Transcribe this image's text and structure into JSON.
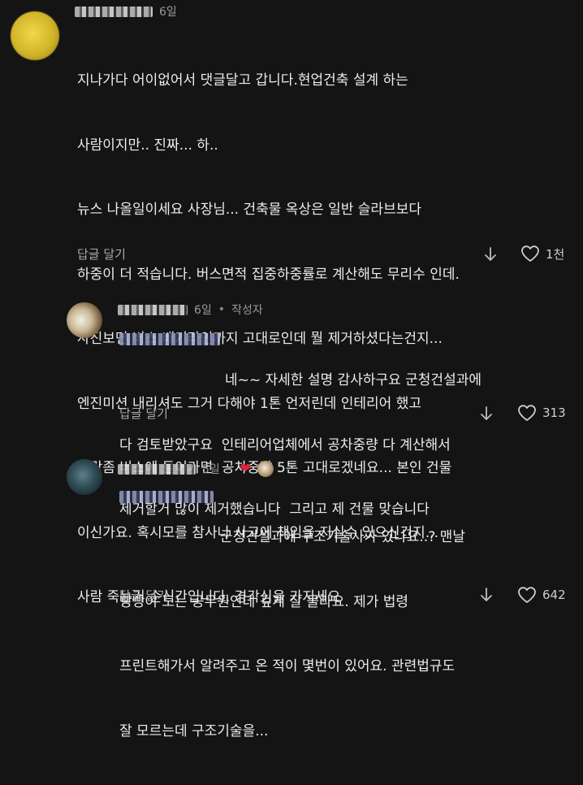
{
  "comments": [
    {
      "time": "6일",
      "lines": [
        "지나가다 어이없어서 댓글달고 갑니다.현업건축 설계 하는",
        "사람이지만.. 진짜... 하..",
        "뉴스 나올일이세요 사장님... 건축물 옥상은 일반 슬라브보다",
        "하중이 더 적습니다. 버스면적 집중하중률로 계산해도 무리수 인데.",
        "사진보면 버스 배기라인까지 고대로인데 뭘 제거하셨다는건지...",
        "엔진미션 내리셔도 그거 다해야 1톤 언저린데 인테리어 했고",
        "사람좀 버스에 들어가면  공차중량 5톤 고대로겠네요... 본인 건물",
        "이신가요. 혹시모를 참사나 사고에 책임을 지실수 있으신건지...",
        "사람 죽는거 순식간입니다. 경각심을 가지세요"
      ],
      "reply_label": "답글 달기",
      "likes": "1천"
    },
    {
      "time": "6일",
      "bullet": "•",
      "author_badge": "작성자",
      "lines": [
        "네~~ 자세한 설명 감사하구요 군청건설과에",
        "다 검토받았구요  인테리어업체에서 공차중량 다 계산해서",
        "제거할거 많이 제거했습니다  그리고 제 건물 맞습니다"
      ],
      "reply_label": "답글 달기",
      "likes": "313"
    },
    {
      "time": "5일",
      "bullet": "•",
      "lines": [
        "군청건설과에 구조기술사가 있나요..? 맨날",
        "빵빵이 도는 공무원인데 깊게 잘 몰라요. 제가 법령",
        "프린트해가서 알려주고 온 적이 몇번이 있어요. 관련법규도",
        "잘 모르는데 구조기술을..."
      ],
      "reply_label": "답글 달기",
      "likes": "642"
    }
  ],
  "colors": {
    "background": "#141414",
    "text": "#ececec",
    "meta": "#9a9a9a",
    "creator_heart": "#e0243a"
  },
  "icons": {
    "reply": "down-arrow-icon",
    "like": "heart-outline-icon",
    "creator_like": "red-heart-icon"
  }
}
